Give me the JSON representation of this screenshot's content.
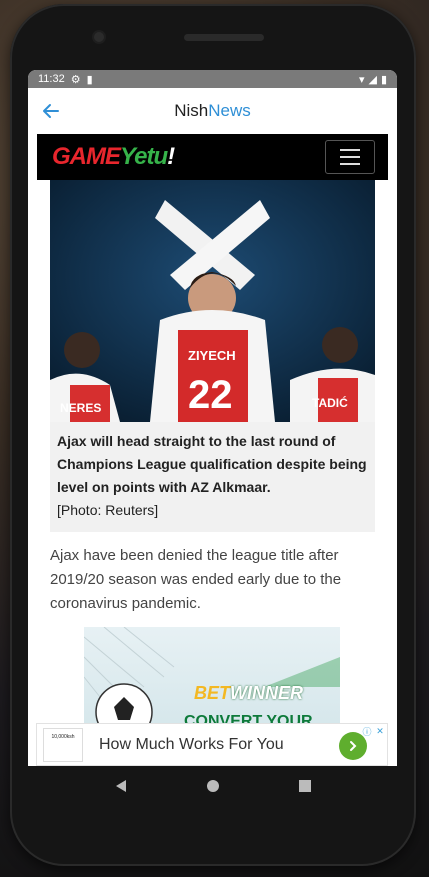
{
  "status_bar": {
    "time": "11:32"
  },
  "app_bar": {
    "title_part1": "Nish",
    "title_part2": "News"
  },
  "site_header": {
    "logo_part1": "GAME",
    "logo_part2": "Yetu",
    "logo_part3": "!"
  },
  "article": {
    "caption_bold": "Ajax will head straight to the last round of Champions League qualification despite being level on points with AZ Alkmaar.",
    "caption_credit": "[Photo: Reuters]",
    "paragraph": "Ajax have been denied the league title after 2019/20 season was ended early due to the coronavirus pandemic.",
    "photo_names": {
      "left": "NERES",
      "center": "ZIYECH",
      "right": "TADIĆ",
      "number": "22"
    }
  },
  "inline_ad": {
    "brand_part1": "BET",
    "brand_part2": "WINNER",
    "subtext": "CONVERT YOUR"
  },
  "bottom_ad": {
    "text": "How Much Works For You",
    "thumb_text": "10,000ksh"
  },
  "colors": {
    "accent": "#2f8fd6",
    "logo_red": "#e8262d",
    "logo_green": "#36b34a",
    "ad_green": "#5fae2e"
  }
}
